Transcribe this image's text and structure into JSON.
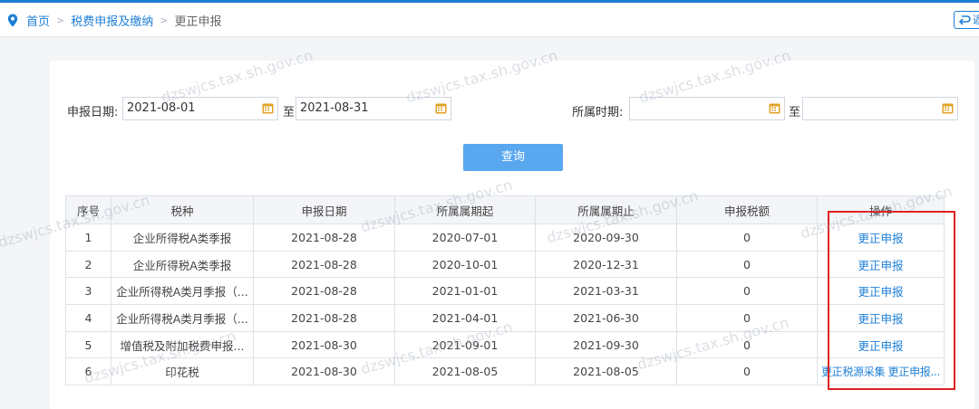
{
  "breadcrumb": {
    "home": "首页",
    "level1": "税费申报及缴纳",
    "current": "更正申报"
  },
  "back_label": "返",
  "filters": {
    "declare_date_label": "申报日期:",
    "declare_date_from": "2021-08-01",
    "to_label": "至",
    "declare_date_to": "2021-08-31",
    "period_label": "所属时期:",
    "period_from": "",
    "period_to": ""
  },
  "query_button": "查询",
  "table": {
    "headers": [
      "序号",
      "税种",
      "申报日期",
      "所属属期起",
      "所属属期止",
      "申报税额",
      "操作"
    ],
    "rows": [
      {
        "no": "1",
        "tax": "企业所得税A类季报",
        "date": "2021-08-28",
        "start": "2020-07-01",
        "end": "2020-09-30",
        "amount": "0",
        "op1": "更正申报",
        "op2": ""
      },
      {
        "no": "2",
        "tax": "企业所得税A类季报",
        "date": "2021-08-28",
        "start": "2020-10-01",
        "end": "2020-12-31",
        "amount": "0",
        "op1": "更正申报",
        "op2": ""
      },
      {
        "no": "3",
        "tax": "企业所得税A类月季报（...",
        "date": "2021-08-28",
        "start": "2021-01-01",
        "end": "2021-03-31",
        "amount": "0",
        "op1": "更正申报",
        "op2": ""
      },
      {
        "no": "4",
        "tax": "企业所得税A类月季报（...",
        "date": "2021-08-28",
        "start": "2021-04-01",
        "end": "2021-06-30",
        "amount": "0",
        "op1": "更正申报",
        "op2": ""
      },
      {
        "no": "5",
        "tax": "增值税及附加税费申报...",
        "date": "2021-08-30",
        "start": "2021-09-01",
        "end": "2021-09-30",
        "amount": "0",
        "op1": "更正申报",
        "op2": ""
      },
      {
        "no": "6",
        "tax": "印花税",
        "date": "2021-08-30",
        "start": "2021-08-05",
        "end": "2021-08-05",
        "amount": "0",
        "op1": "更正税源采集",
        "op2": "更正申报..."
      }
    ]
  },
  "watermark": "dzswjcs.tax.sh.gov.cn",
  "colors": {
    "accent": "#1e7fd6",
    "query_button": "#58a7ef",
    "highlight_box": "#e02020",
    "calendar_icon": "#e0a226"
  }
}
